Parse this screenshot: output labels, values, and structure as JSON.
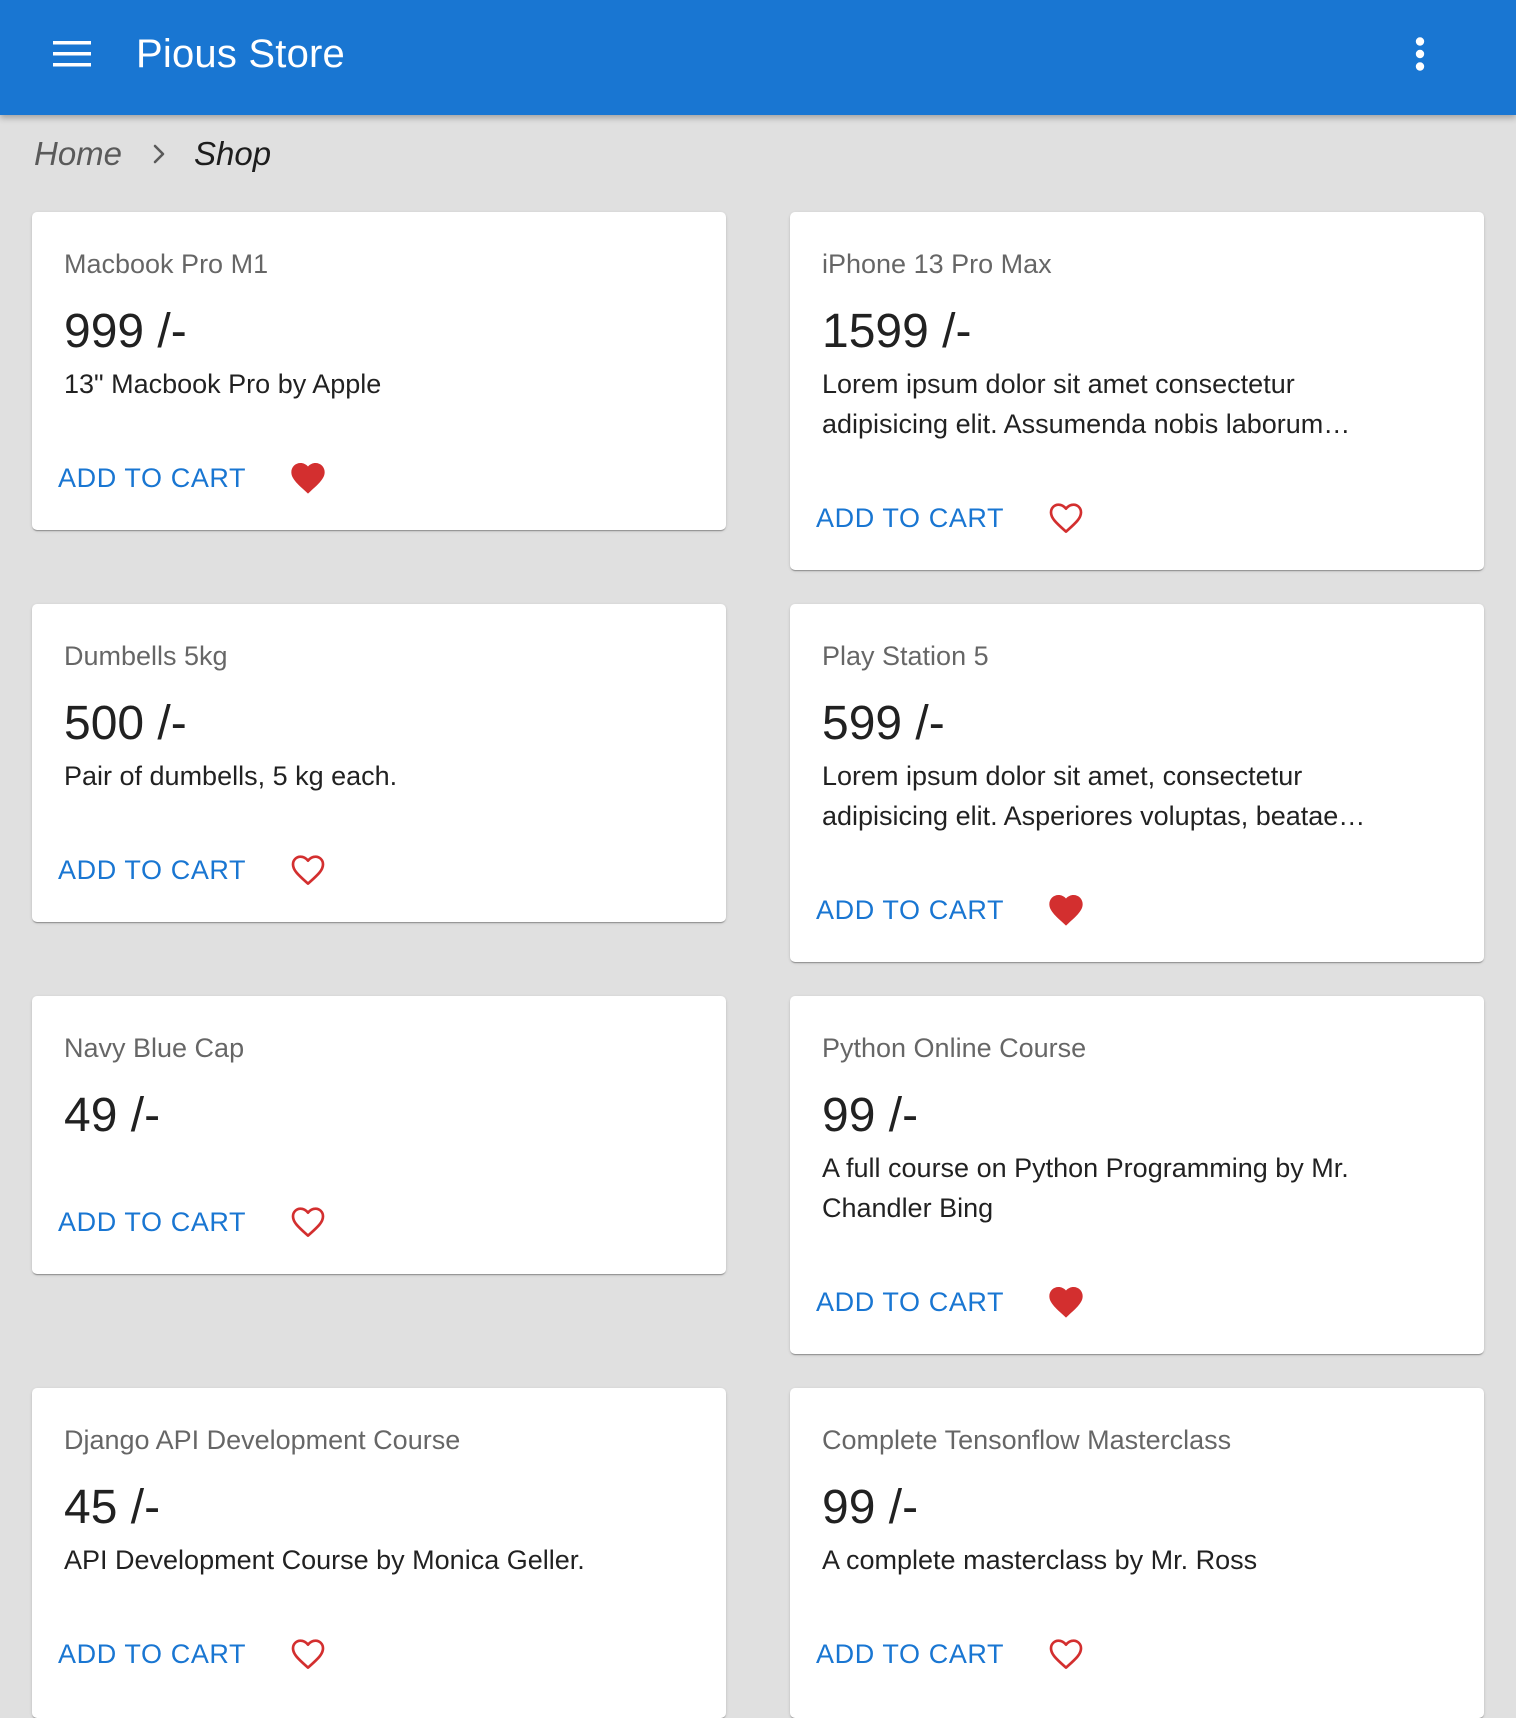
{
  "app": {
    "title": "Pious Store",
    "menu_icon": "menu-icon",
    "more_icon": "more-vert-icon",
    "bar_color": "#1976d2"
  },
  "breadcrumb": {
    "home": "Home",
    "separator_icon": "chevron-right-icon",
    "current": "Shop"
  },
  "colors": {
    "accent": "#1976d2",
    "favorite": "#d32f2f",
    "background": "#e0e0e0"
  },
  "products": [
    {
      "title": "Macbook Pro M1",
      "price": "999 /-",
      "description": "13\" Macbook Pro by Apple",
      "action": "ADD TO CART",
      "favorited": true
    },
    {
      "title": "iPhone 13 Pro Max",
      "price": "1599 /-",
      "description": "Lorem ipsum dolor sit amet consectetur adipisicing elit. Assumenda nobis laborum…",
      "action": "ADD TO CART",
      "favorited": false
    },
    {
      "title": "Dumbells 5kg",
      "price": "500 /-",
      "description": "Pair of dumbells, 5 kg each.",
      "action": "ADD TO CART",
      "favorited": false
    },
    {
      "title": "Play Station 5",
      "price": "599 /-",
      "description": "Lorem ipsum dolor sit amet, consectetur adipisicing elit. Asperiores voluptas, beatae…",
      "action": "ADD TO CART",
      "favorited": true
    },
    {
      "title": "Navy Blue Cap",
      "price": "49 /-",
      "description": "",
      "action": "ADD TO CART",
      "favorited": false
    },
    {
      "title": "Python Online Course",
      "price": "99 /-",
      "description": "A full course on Python Programming by Mr. Chandler Bing",
      "action": "ADD TO CART",
      "favorited": true
    },
    {
      "title": "Django API Development Course",
      "price": "45 /-",
      "description": "API Development Course by Monica Geller.",
      "action": "ADD TO CART",
      "favorited": false
    },
    {
      "title": "Complete Tensonflow Masterclass",
      "price": "99 /-",
      "description": "A complete masterclass by Mr. Ross",
      "action": "ADD TO CART",
      "favorited": false
    }
  ]
}
